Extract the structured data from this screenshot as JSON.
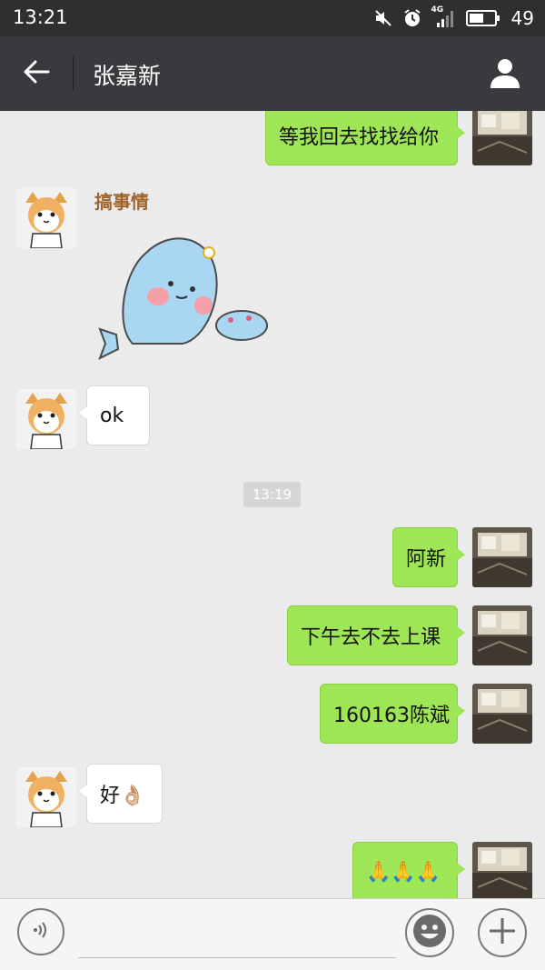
{
  "status_bar": {
    "time": "13:21",
    "network": "4G",
    "battery": "49",
    "icons": [
      "mute-icon",
      "alarm-icon",
      "signal-icon",
      "battery-icon"
    ]
  },
  "header": {
    "title": "张嘉新",
    "back_icon": "arrow-left-icon",
    "profile_icon": "person-icon"
  },
  "sticker": {
    "caption": "搞事情"
  },
  "messages": [
    {
      "from": "me",
      "text": "等我回去找找给你"
    },
    {
      "from": "them",
      "type": "sticker"
    },
    {
      "from": "them",
      "text": "ok"
    },
    {
      "type": "timestamp",
      "text": "13:19"
    },
    {
      "from": "me",
      "text": "阿新"
    },
    {
      "from": "me",
      "text": "下午去不去上课"
    },
    {
      "from": "me",
      "text": "160163陈斌"
    },
    {
      "from": "them",
      "text": "好👌🏼"
    },
    {
      "from": "me",
      "text": "🙏🙏🙏"
    }
  ],
  "input_bar": {
    "placeholder": "",
    "icons": [
      "voice-icon",
      "emoji-icon",
      "plus-icon"
    ]
  },
  "colors": {
    "status_bg": "#2f2f2f",
    "header_bg": "#393a3e",
    "chat_bg": "#ebebeb",
    "my_bubble": "#9fe657",
    "their_bubble": "#ffffff"
  }
}
